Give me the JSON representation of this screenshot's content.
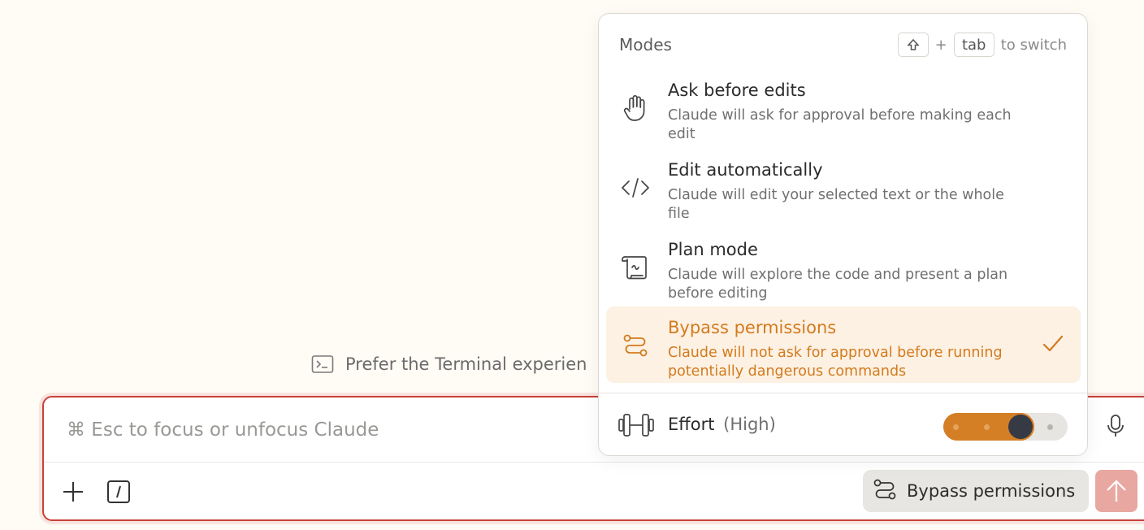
{
  "terminal_hint": {
    "text": "Prefer the Terminal experien"
  },
  "composer": {
    "placeholder": "⌘ Esc to focus or unfocus Claude",
    "mode_chip_label": "Bypass permissions"
  },
  "modes_popover": {
    "title": "Modes",
    "switch_hint": {
      "plus": "+",
      "key": "tab",
      "suffix": "to switch"
    },
    "items": [
      {
        "label": "Ask before edits",
        "description": "Claude will ask for approval before making each edit",
        "icon": "hand-icon",
        "selected": false
      },
      {
        "label": "Edit automatically",
        "description": "Claude will edit your selected text or the whole file",
        "icon": "code-icon",
        "selected": false
      },
      {
        "label": "Plan mode",
        "description": "Claude will explore the code and present a plan before editing",
        "icon": "scroll-icon",
        "selected": false
      },
      {
        "label": "Bypass permissions",
        "description": "Claude will not ask for approval before running potentially dangerous commands",
        "icon": "route-icon",
        "selected": true
      }
    ],
    "effort": {
      "label": "Effort",
      "level": "(High)",
      "level_index": 3,
      "level_count": 4
    }
  },
  "colors": {
    "accent": "#d27b1f",
    "selected_bg": "#fdf1e3",
    "composer_border": "#c9413a",
    "send_button": "#e8a7a1",
    "background": "#fffbf5"
  }
}
